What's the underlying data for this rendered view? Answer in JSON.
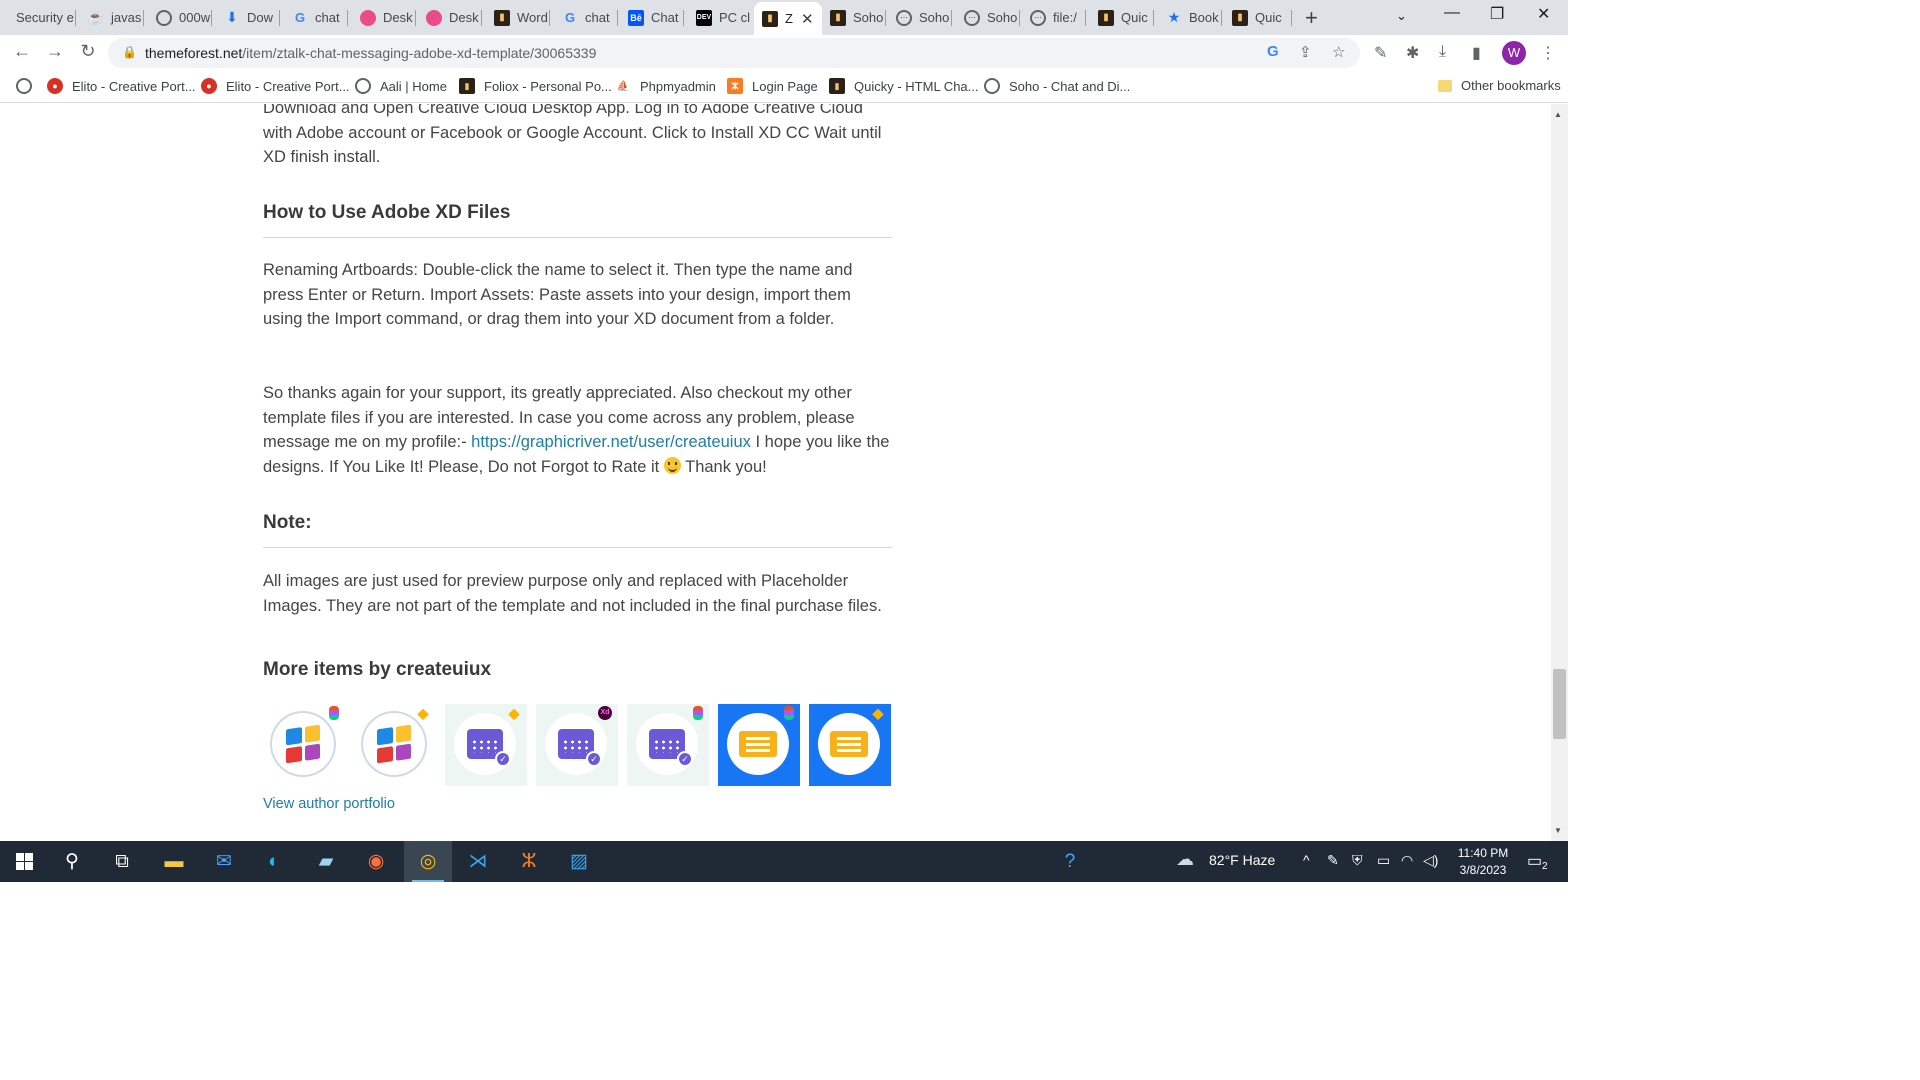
{
  "tabs": [
    {
      "label": "Security e",
      "icon": "shield-icon"
    },
    {
      "label": "javas",
      "icon": "java-icon"
    },
    {
      "label": "000w",
      "icon": "globe-icon"
    },
    {
      "label": "Dow",
      "icon": "download-icon"
    },
    {
      "label": "chat",
      "icon": "google-icon"
    },
    {
      "label": "Desk",
      "icon": "dribbble-icon"
    },
    {
      "label": "Desk",
      "icon": "dribbble-icon"
    },
    {
      "label": "Word",
      "icon": "themeforest-icon"
    },
    {
      "label": "chat",
      "icon": "google-icon"
    },
    {
      "label": "Chat",
      "icon": "behance-icon"
    },
    {
      "label": "PC cl",
      "icon": "dev-icon"
    },
    {
      "label": "Z",
      "icon": "themeforest-icon",
      "active": true
    },
    {
      "label": "Soho",
      "icon": "themeforest-icon"
    },
    {
      "label": "Soho",
      "icon": "chat-icon"
    },
    {
      "label": "Soho",
      "icon": "chat-icon"
    },
    {
      "label": "file:/",
      "icon": "chat-icon"
    },
    {
      "label": "Quic",
      "icon": "themeforest-icon"
    },
    {
      "label": "Book",
      "icon": "star-icon"
    },
    {
      "label": "Quic",
      "icon": "themeforest-icon"
    }
  ],
  "address": {
    "host": "themeforest.net",
    "path": "/item/ztalk-chat-messaging-adobe-xd-template/30065339"
  },
  "profile": {
    "initial": "W",
    "color": "#8e24aa"
  },
  "bookmarks": [
    {
      "label": "",
      "icon": "globe-icon"
    },
    {
      "label": "Elito - Creative Port...",
      "icon": "red-logo-icon"
    },
    {
      "label": "Elito - Creative Port...",
      "icon": "red-logo-icon"
    },
    {
      "label": "Aali | Home",
      "icon": "globe-icon"
    },
    {
      "label": "Foliox - Personal Po...",
      "icon": "themeforest-icon"
    },
    {
      "label": "Phpmyadmin",
      "icon": "phpmyadmin-icon"
    },
    {
      "label": "Login Page",
      "icon": "xampp-icon"
    },
    {
      "label": "Quicky - HTML Cha...",
      "icon": "themeforest-icon"
    },
    {
      "label": "Soho - Chat and Di...",
      "icon": "chat-icon"
    },
    {
      "label": "Other bookmarks",
      "icon": "folder-icon"
    }
  ],
  "article": {
    "install_text": "Download and Open Creative Cloud Desktop App. Log in to Adobe Creative Cloud with Adobe account or Facebook or Google Account. Click to Install XD CC Wait until XD finish install.",
    "how_to_heading": "How to Use Adobe XD Files",
    "how_to_text": "Renaming Artboards: Double-click the name to select it. Then type the name and press Enter or Return. Import Assets: Paste assets into your design, import them using the Import command, or drag them into your XD document from a folder.",
    "thanks_text_before": "So thanks again for your support, its greatly appreciated. Also checkout my other template files if you are interested. In case you come across any problem, please message me on my profile:- ",
    "thanks_link": "https://graphicriver.net/user/createuiux",
    "thanks_text_after": " I hope you like the designs. If You Like It! Please, Do not Forgot to Rate it ",
    "thanks_end": " Thank you!",
    "note_heading": "Note:",
    "note_text": "All images are just used for preview purpose only and replaced with Placeholder Images. They are not part of the template and not included in the final purchase files.",
    "more_heading": "More items by createuiux",
    "portfolio_link": "View author portfolio"
  },
  "more_items": [
    {
      "name": "windows-figma-item",
      "kind": "windows",
      "badge": "figma"
    },
    {
      "name": "windows-sketch-item",
      "kind": "windows",
      "badge": "sketch"
    },
    {
      "name": "calendar-sketch-item",
      "kind": "calendar",
      "badge": "sketch"
    },
    {
      "name": "calendar-xd-item",
      "kind": "calendar",
      "badge": "xd"
    },
    {
      "name": "calendar-figma-item",
      "kind": "calendar",
      "badge": "figma"
    },
    {
      "name": "ticket-figma-item",
      "kind": "ticket",
      "badge": "figma"
    },
    {
      "name": "ticket-sketch-item",
      "kind": "ticket",
      "badge": "sketch"
    }
  ],
  "taskbar": {
    "weather": "82°F  Haze",
    "time": "11:40 PM",
    "date": "3/8/2023",
    "notifications": "2"
  },
  "colors": {
    "link": "#1d7ca8",
    "tab_strip": "#dee1e6",
    "taskbar": "#1f2a36"
  }
}
